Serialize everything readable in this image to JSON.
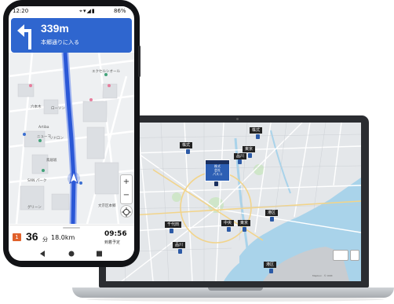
{
  "phone": {
    "status_bar": {
      "time": "12:20",
      "battery": "86%"
    },
    "guidance": {
      "distance": "339m",
      "street": "本郷通りに入る"
    },
    "map": {
      "labels": [
        "エクセルシオール",
        "六本木",
        "ローソン",
        "Artiba",
        "ニューマ",
        "鳥居坂",
        "SAN パーク",
        "リドロン",
        "グリーン",
        "文京区本郷"
      ]
    },
    "bottom": {
      "badge": "1",
      "minutes": "36",
      "minutes_unit": "分",
      "distance": "18.0km",
      "arrival_time": "09:56",
      "arrival_label": "到着予定"
    }
  },
  "laptop": {
    "map_labels": [
      "株式",
      "株式",
      "東京",
      "千代田",
      "中央",
      "東京",
      "港区",
      "品川",
      "港区",
      "品川"
    ],
    "popup": [
      "株式",
      "会社",
      "パスコ"
    ],
    "attribution": "Mapbox · © OSM"
  },
  "colors": {
    "banner_blue": "#2f66cf",
    "route_blue": "#2a57d6",
    "badge_orange": "#e0612b",
    "water": "#a9d3ea"
  }
}
